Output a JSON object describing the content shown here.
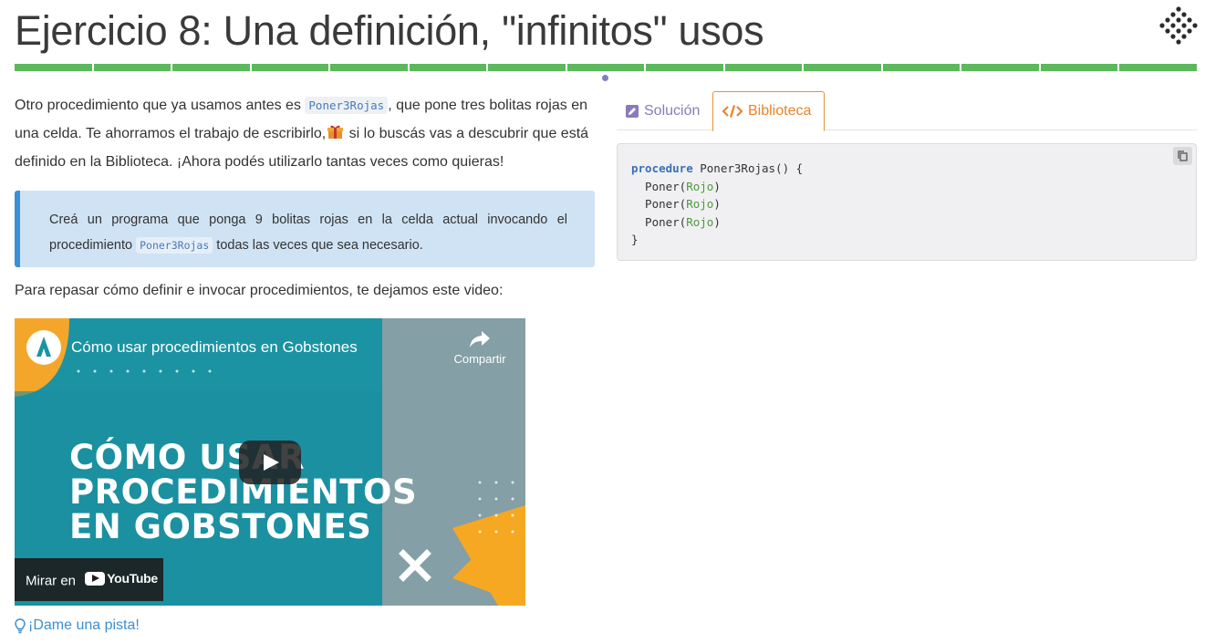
{
  "header": {
    "title": "Ejercicio 8: Una definición, \"infinitos\" usos",
    "progress_segments": 15
  },
  "intro": {
    "part1": "Otro procedimiento que ya usamos antes es ",
    "code": "Poner3Rojas",
    "part2": ", que pone tres bolitas rojas en una celda. Te ahorramos el trabajo de escribirlo,",
    "part3": " si lo buscás vas a descubrir que está definido en la Biblioteca. ¡Ahora podés utilizarlo tantas veces como quieras!"
  },
  "task": {
    "part1": "Creá un programa que ponga 9 bolitas rojas en la celda actual invocando el procedimiento ",
    "code": "Poner3Rojas",
    "part2": " todas las veces que sea necesario."
  },
  "video_intro": "Para repasar cómo definir e invocar procedimientos, te dejamos este video:",
  "video": {
    "title": "Cómo usar procedimientos en Gobstones",
    "share": "Compartir",
    "headline_1": "CÓMO USAR",
    "headline_2": "PROCEDIMIENTOS",
    "headline_3": "EN GOBSTONES",
    "watch_on": "Mirar en",
    "youtube": "YouTube"
  },
  "hint": "¡Dame una pista!",
  "tabs": {
    "solution": "Solución",
    "library": "Biblioteca"
  },
  "library_code": {
    "keyword": "procedure",
    "signature": " Poner3Rojas() {",
    "lines": [
      {
        "fn": "  Poner(",
        "arg": "Rojo",
        "end": ")"
      },
      {
        "fn": "  Poner(",
        "arg": "Rojo",
        "end": ")"
      },
      {
        "fn": "  Poner(",
        "arg": "Rojo",
        "end": ")"
      }
    ],
    "close": "}"
  },
  "colors": {
    "progress": "#5cb85c",
    "callout_bg": "#cfe3f4",
    "callout_border": "#3a8fd9",
    "library_tab": "#e8842a",
    "solution_tab": "#8a7bbd",
    "link": "#3d8fd0"
  }
}
